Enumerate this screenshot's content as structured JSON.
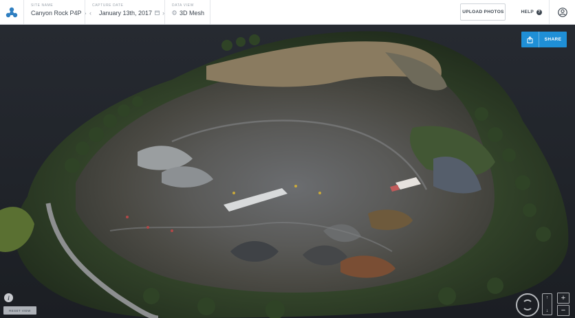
{
  "header": {
    "site_label": "SITE NAME",
    "site_value": "Canyon Rock P4P",
    "date_label": "CAPTURE DATE",
    "date_value": "January 13th, 2017",
    "view_label": "DATA VIEW",
    "view_value": "3D Mesh",
    "upload_label": "UPLOAD PHOTOS",
    "help_label": "HELP"
  },
  "toolbar": {
    "share_label": "SHARE",
    "reset_label": "RESET VIEW"
  },
  "icons": {
    "logo": "brand-logo-icon",
    "chevron": "chevron-right-icon",
    "calendar": "calendar-icon",
    "view": "mesh-icon",
    "help": "help-icon",
    "user": "user-icon",
    "share": "share-icon",
    "info": "info-icon",
    "orbit": "orbit-icon",
    "pan": "vertical-pan-icon",
    "zoom_in": "zoom-in-icon",
    "zoom_out": "zoom-out-icon"
  },
  "colors": {
    "accent": "#1f8fd6",
    "logo": "#2f7fc1",
    "header_bg": "#ffffff",
    "scene_bg": "#20242a"
  }
}
